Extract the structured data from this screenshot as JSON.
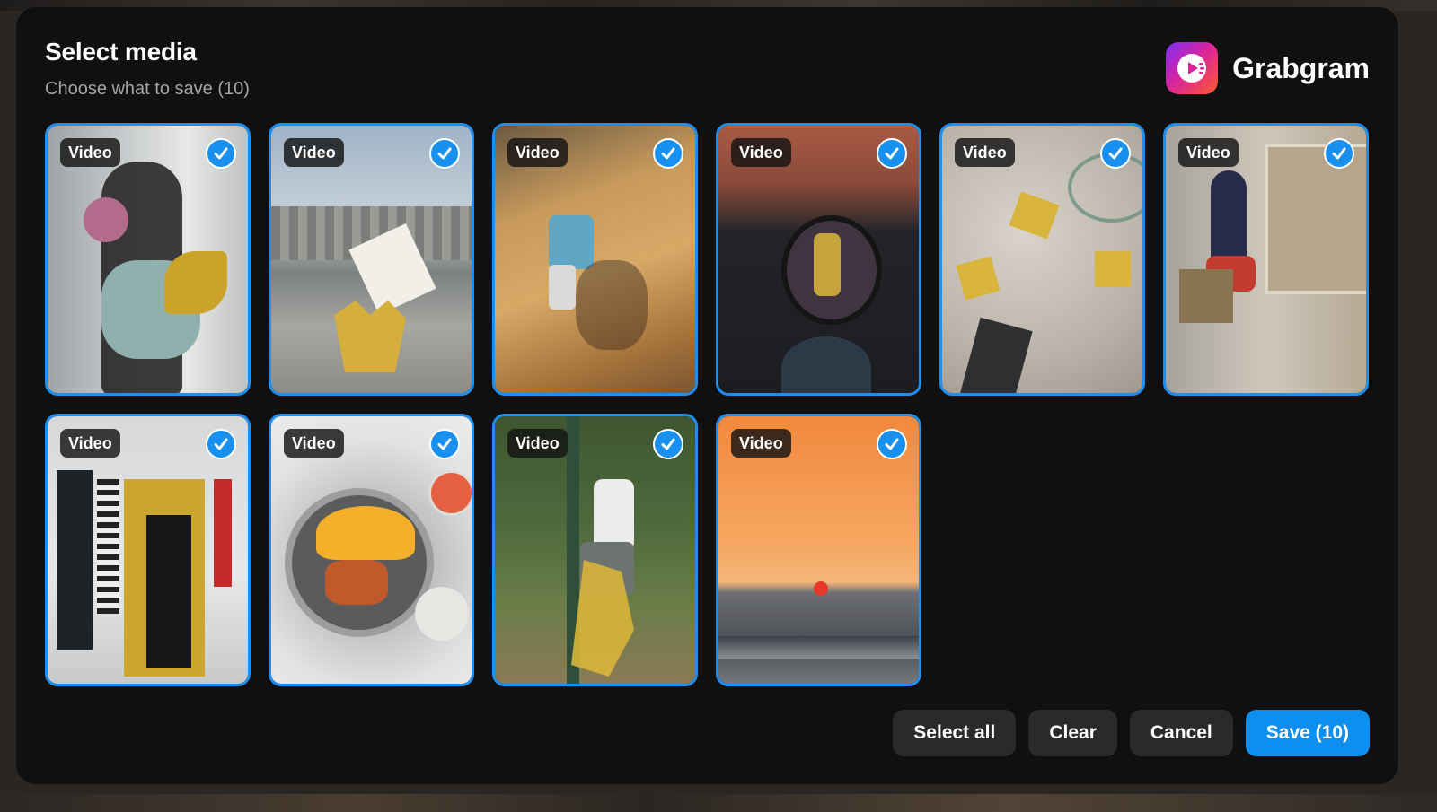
{
  "modal": {
    "title": "Select media",
    "subtitle": "Choose what to save (10)"
  },
  "brand": {
    "name": "Grabgram",
    "icon": "play-icon",
    "colors": [
      "#7b2ff7",
      "#d6249f",
      "#ff5a2c"
    ]
  },
  "accent_color": "#1d8ff0",
  "media_items": [
    {
      "type_label": "Video",
      "selected": true
    },
    {
      "type_label": "Video",
      "selected": true
    },
    {
      "type_label": "Video",
      "selected": true
    },
    {
      "type_label": "Video",
      "selected": true
    },
    {
      "type_label": "Video",
      "selected": true
    },
    {
      "type_label": "Video",
      "selected": true
    },
    {
      "type_label": "Video",
      "selected": true
    },
    {
      "type_label": "Video",
      "selected": true
    },
    {
      "type_label": "Video",
      "selected": true
    },
    {
      "type_label": "Video",
      "selected": true
    }
  ],
  "actions": {
    "select_all": "Select all",
    "clear": "Clear",
    "cancel": "Cancel",
    "save": "Save (10)"
  }
}
